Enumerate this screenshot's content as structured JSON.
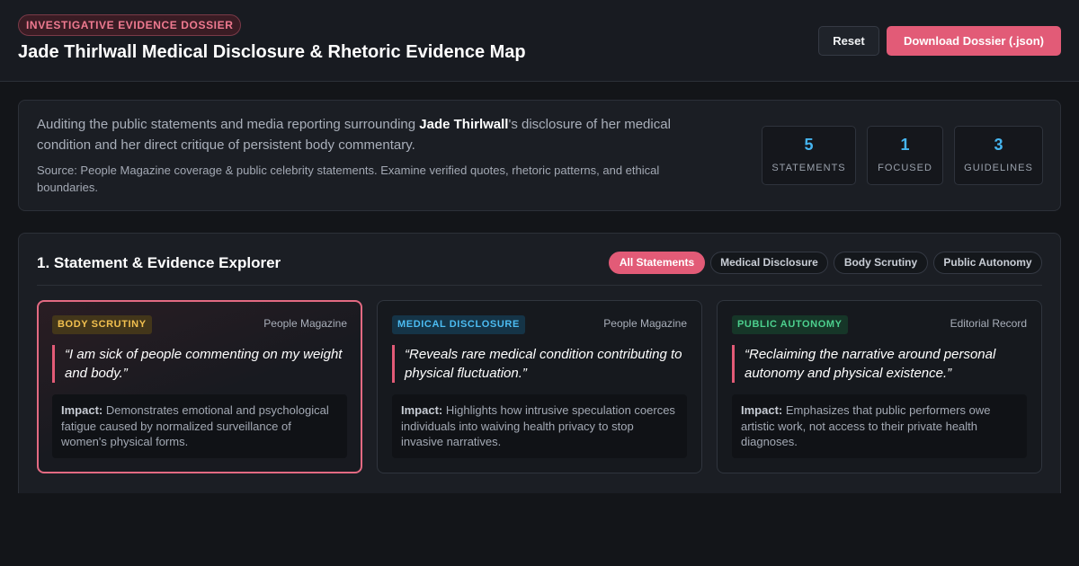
{
  "header": {
    "badge": "INVESTIGATIVE EVIDENCE DOSSIER",
    "title": "Jade Thirlwall Medical Disclosure & Rhetoric Evidence Map",
    "reset_label": "Reset",
    "download_label": "Download Dossier (.json)"
  },
  "intro": {
    "text_before": "Auditing the public statements and media reporting surrounding ",
    "subject": "Jade Thirlwall",
    "text_after": "'s disclosure of her medical condition and her direct critique of persistent body commentary.",
    "source": "Source: People Magazine coverage & public celebrity statements. Examine verified quotes, rhetoric patterns, and ethical boundaries."
  },
  "stats": [
    {
      "value": "5",
      "label": "STATEMENTS"
    },
    {
      "value": "1",
      "label": "FOCUSED"
    },
    {
      "value": "3",
      "label": "GUIDELINES"
    }
  ],
  "explorer": {
    "title": "1. Statement & Evidence Explorer",
    "filters": [
      {
        "label": "All Statements",
        "active": true
      },
      {
        "label": "Medical Disclosure",
        "active": false
      },
      {
        "label": "Body Scrutiny",
        "active": false
      },
      {
        "label": "Public Autonomy",
        "active": false
      }
    ],
    "impact_label": "Impact:",
    "cards": [
      {
        "tag": "BODY SCRUTINY",
        "source": "People Magazine",
        "quote": "“I am sick of people commenting on my weight and body.”",
        "impact": "Demonstrates emotional and psychological fatigue caused by normalized surveillance of women's physical forms."
      },
      {
        "tag": "MEDICAL DISCLOSURE",
        "source": "People Magazine",
        "quote": "“Reveals rare medical condition contributing to physical fluctuation.”",
        "impact": "Highlights how intrusive speculation coerces individuals into waiving health privacy to stop invasive narratives."
      },
      {
        "tag": "PUBLIC AUTONOMY",
        "source": "Editorial Record",
        "quote": "“Reclaiming the narrative around personal autonomy and physical existence.”",
        "impact": "Emphasizes that public performers owe artistic work, not access to their private health diagnoses."
      }
    ]
  },
  "colors": {
    "accent": "#e25b77",
    "stat_value": "#46b5f0",
    "tag_body": "#f2c04f",
    "tag_medical": "#4cbcf2",
    "tag_autonomy": "#4cd08e"
  }
}
